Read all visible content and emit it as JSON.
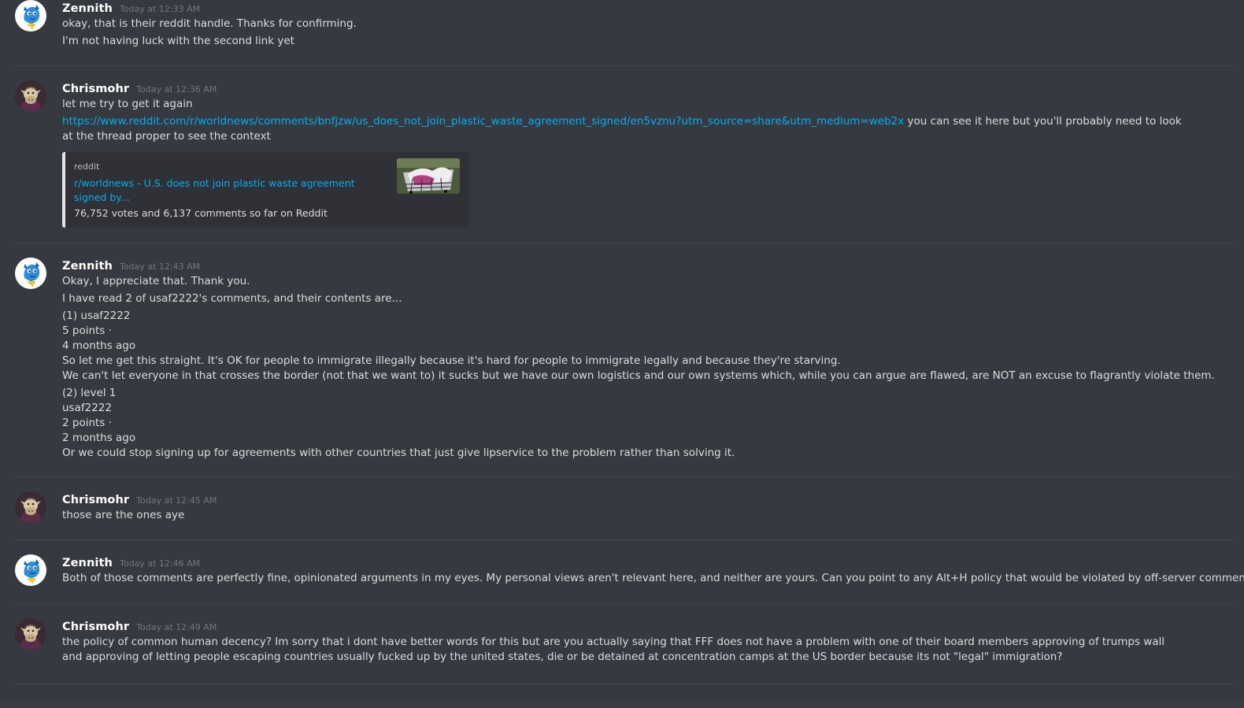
{
  "colors": {
    "background": "#36393f",
    "username": "#ffffff",
    "timestamp": "#72767d",
    "text": "#dcddde",
    "link": "#00b0f4",
    "embed_bg": "#2f3136",
    "embed_border": "#e3e5e8"
  },
  "messages": [
    {
      "author": "Zennith",
      "avatar_icon": "blue-dragon-avatar-icon",
      "timestamp": "Today at 12:33 AM",
      "lines": [
        "okay, that is their reddit handle. Thanks for confirming.",
        "I'm not having luck with the second link yet"
      ]
    },
    {
      "author": "Chrismohr",
      "avatar_icon": "cow-avatar-icon",
      "timestamp": "Today at 12:36 AM",
      "lines": [
        "let me try to get it again"
      ],
      "link": "https://www.reddit.com/r/worldnews/comments/bnfjzw/us_does_not_join_plastic_waste_agreement_signed/en5vznu?utm_source=share&utm_medium=web2x",
      "link_suffix": " you can see it here but you'll probably need to look at the thread proper to see the context",
      "embed": {
        "provider": "reddit",
        "title": "r/worldnews - U.S. does not join plastic waste agreement signed by...",
        "description": "76,752 votes and 6,137 comments so far on Reddit",
        "thumbnail_icon": "shopping-cart-plastic-thumbnail"
      }
    },
    {
      "author": "Zennith",
      "avatar_icon": "blue-dragon-avatar-icon",
      "timestamp": "Today at 12:43 AM",
      "lines": [
        "Okay, I appreciate that. Thank you.",
        "I have read 2 of usaf2222's comments, and their contents are...",
        "(1) usaf2222",
        "5 points ·",
        "4 months ago",
        "So let me get this straight. It's OK for people to immigrate illegally because it's hard for people to immigrate legally and because they're starving.",
        "We can't let everyone in that crosses the border (not that we want to) it sucks but we have our own logistics and our own systems which, while you can argue are flawed, are NOT an excuse to flagrantly violate them.",
        "(2) level 1",
        "usaf2222",
        "2 points ·",
        "2 months ago",
        "Or we could stop signing up for agreements with other countries that just give lipservice to the problem rather than solving it."
      ]
    },
    {
      "author": "Chrismohr",
      "avatar_icon": "cow-avatar-icon",
      "timestamp": "Today at 12:45 AM",
      "lines": [
        "those are the ones aye"
      ]
    },
    {
      "author": "Zennith",
      "avatar_icon": "blue-dragon-avatar-icon",
      "timestamp": "Today at 12:46 AM",
      "lines": [
        "Both of those comments are perfectly fine, opinionated arguments in my eyes. My personal views aren't relevant here, and neither are yours. Can you point to any Alt+H policy that would be violated by off-server comments like that?"
      ]
    },
    {
      "author": "Chrismohr",
      "avatar_icon": "cow-avatar-icon",
      "timestamp": "Today at 12:49 AM",
      "lines": [
        "the policy of common human decency? Im sorry that i dont have better words for this but are you actually saying that FFF does not have a problem with one of their board members approving of trumps wall and approving of letting people escaping countries usually fucked up by the united states, die or be detained at concentration camps at the US border because its not \"legal\" immigration?"
      ]
    }
  ]
}
